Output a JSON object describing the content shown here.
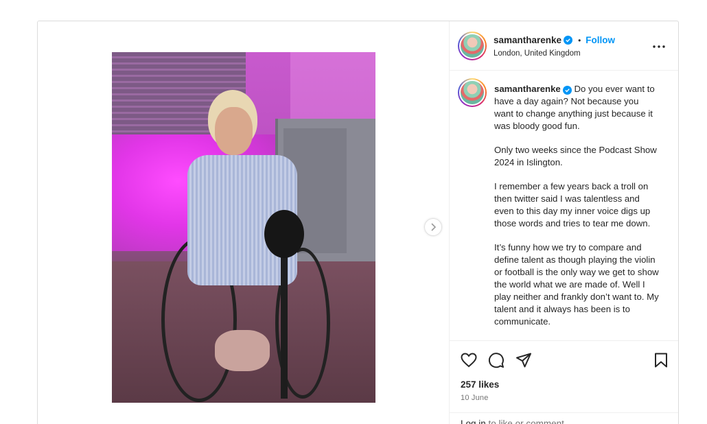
{
  "post": {
    "username": "samantharenke",
    "follow_label": "Follow",
    "separator": "•",
    "location": "London, United Kingdom",
    "caption_paragraphs": [
      "Do you ever want to have a day again? Not because you want to change anything just because it was bloody good fun.",
      "Only two weeks since the Podcast Show 2024 in Islington.",
      "I remember a few years back a troll on then twitter said I was talentless and even to this day my inner voice digs up those words and tries to tear me down.",
      "It’s funny how we try to compare and define talent as though playing the violin or football is the only way we get to show the world what we are made of. Well I play neither and frankly don’t want to. My talent and it always has been is to communicate."
    ],
    "likes": "257 likes",
    "date": "10 June",
    "login_link": "Log in",
    "login_rest": " to like or comment."
  },
  "icons": {
    "verified": "verified-badge-icon",
    "more": "more-options-icon",
    "next": "chevron-right-icon",
    "like": "heart-icon",
    "comment": "comment-icon",
    "share": "share-icon",
    "save": "bookmark-icon"
  },
  "colors": {
    "accent": "#0095f6",
    "text": "#262626",
    "muted": "#737373",
    "border": "#dbdbdb"
  }
}
